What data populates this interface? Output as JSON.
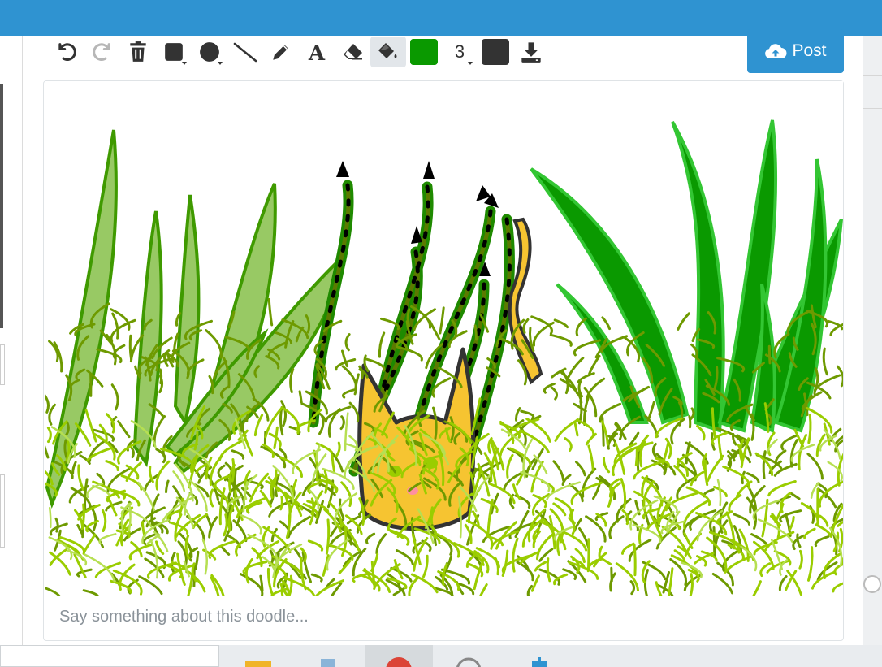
{
  "toolbar": {
    "tools": [
      {
        "name": "undo-icon",
        "enabled": true
      },
      {
        "name": "redo-icon",
        "enabled": false
      },
      {
        "name": "trash-icon",
        "enabled": true
      },
      {
        "name": "rectangle-icon",
        "enabled": true
      },
      {
        "name": "ellipse-icon",
        "enabled": true
      },
      {
        "name": "line-icon",
        "enabled": true
      },
      {
        "name": "pencil-icon",
        "enabled": true
      },
      {
        "name": "text-icon",
        "enabled": true
      },
      {
        "name": "eraser-icon",
        "enabled": true
      },
      {
        "name": "fill-bucket-icon",
        "enabled": true,
        "active": true
      }
    ],
    "primary_color": "#0a9900",
    "brush_size": "3",
    "secondary_color": "#333333",
    "download_icon": "download-icon",
    "text_glyph": "A"
  },
  "post_button": {
    "label": "Post",
    "icon": "cloud-upload-icon"
  },
  "comment": {
    "placeholder": "Say something about this doodle..."
  },
  "colors": {
    "header": "#2f93d1",
    "grass_dark": "#6e9a00",
    "grass_light": "#9acd00",
    "leaf_light": "#98c964",
    "leaf_dark": "#0a9900",
    "cat": "#f6c431"
  },
  "taskbar": {
    "apps": [
      "file-explorer-icon",
      "notepad-icon",
      "chrome-icon",
      "media-icon",
      "generic-app-icon"
    ]
  }
}
